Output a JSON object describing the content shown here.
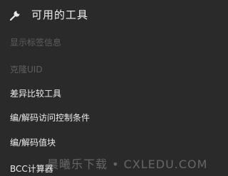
{
  "header": {
    "icon": "wrench-icon",
    "title": "可用的工具"
  },
  "menu": {
    "items": [
      {
        "label": "显示标签信息",
        "enabled": false
      },
      {
        "label": "克隆UID",
        "enabled": false
      },
      {
        "label": "差异比较工具",
        "enabled": true
      },
      {
        "label": "编/解码访问控制条件",
        "enabled": true
      },
      {
        "label": "编/解码值块",
        "enabled": true
      },
      {
        "label": "BCC计算器",
        "enabled": true
      }
    ]
  },
  "watermark": {
    "text": "晨曦乐下载 • CXLEDU.COM"
  },
  "colors": {
    "background": "#2a2a2a",
    "text_enabled": "#ededed",
    "text_disabled": "#5f5f5f"
  }
}
